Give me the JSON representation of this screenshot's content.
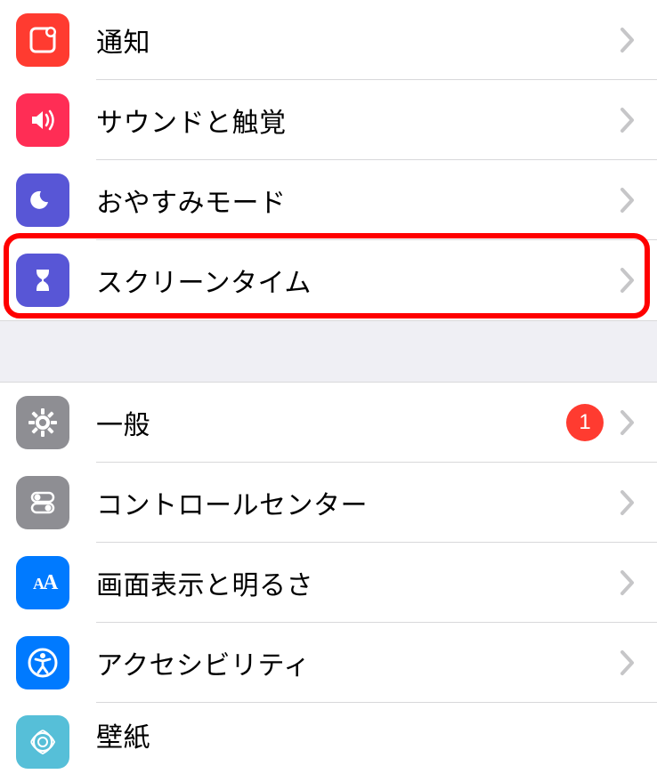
{
  "group1": {
    "items": [
      {
        "label": "通知",
        "icon": "notifications-icon",
        "bg": "bg-red"
      },
      {
        "label": "サウンドと触覚",
        "icon": "sounds-icon",
        "bg": "bg-pink"
      },
      {
        "label": "おやすみモード",
        "icon": "dnd-icon",
        "bg": "bg-purple"
      },
      {
        "label": "スクリーンタイム",
        "icon": "screentime-icon",
        "bg": "bg-purple"
      }
    ]
  },
  "group2": {
    "items": [
      {
        "label": "一般",
        "icon": "general-icon",
        "bg": "bg-gray",
        "badge": "1"
      },
      {
        "label": "コントロールセンター",
        "icon": "controlcenter-icon",
        "bg": "bg-gray"
      },
      {
        "label": "画面表示と明るさ",
        "icon": "display-icon",
        "bg": "bg-blue"
      },
      {
        "label": "アクセシビリティ",
        "icon": "accessibility-icon",
        "bg": "bg-blue"
      },
      {
        "label": "壁紙",
        "icon": "wallpaper-icon",
        "bg": "bg-cyan"
      }
    ]
  },
  "highlighted_index": 3
}
